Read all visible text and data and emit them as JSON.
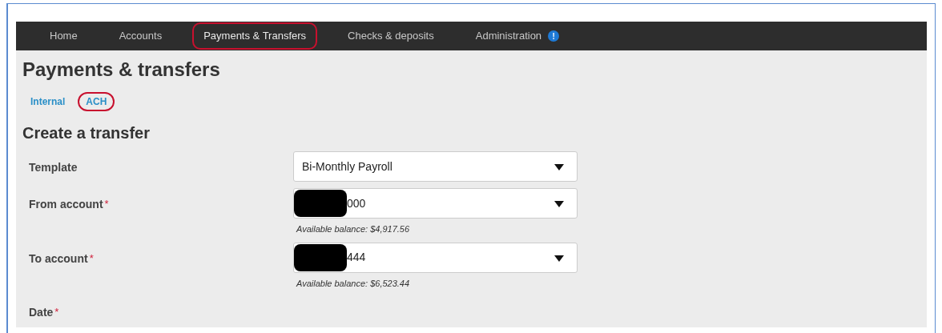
{
  "nav": {
    "items": [
      {
        "label": "Home",
        "highlighted": false
      },
      {
        "label": "Accounts",
        "highlighted": false
      },
      {
        "label": "Payments & Transfers",
        "highlighted": true
      },
      {
        "label": "Checks & deposits",
        "highlighted": false
      },
      {
        "label": "Administration",
        "highlighted": false,
        "badge": "!"
      }
    ]
  },
  "page_title": "Payments & transfers",
  "tabs": [
    {
      "label": "Internal",
      "highlighted": false
    },
    {
      "label": "ACH",
      "highlighted": true
    }
  ],
  "section_title": "Create a transfer",
  "form": {
    "fields": [
      {
        "label": "Template",
        "value": "Bi-Monthly Payroll"
      },
      {
        "label": "From account",
        "required_mark": "*",
        "value": "000",
        "redacted": true,
        "note": "Available balance: $4,917.56"
      },
      {
        "label": "To account",
        "required_mark": "*",
        "value": "444",
        "redacted": true,
        "note": "Available balance: $6,523.44"
      },
      {
        "label": "Date",
        "required_mark": "*"
      }
    ]
  }
}
